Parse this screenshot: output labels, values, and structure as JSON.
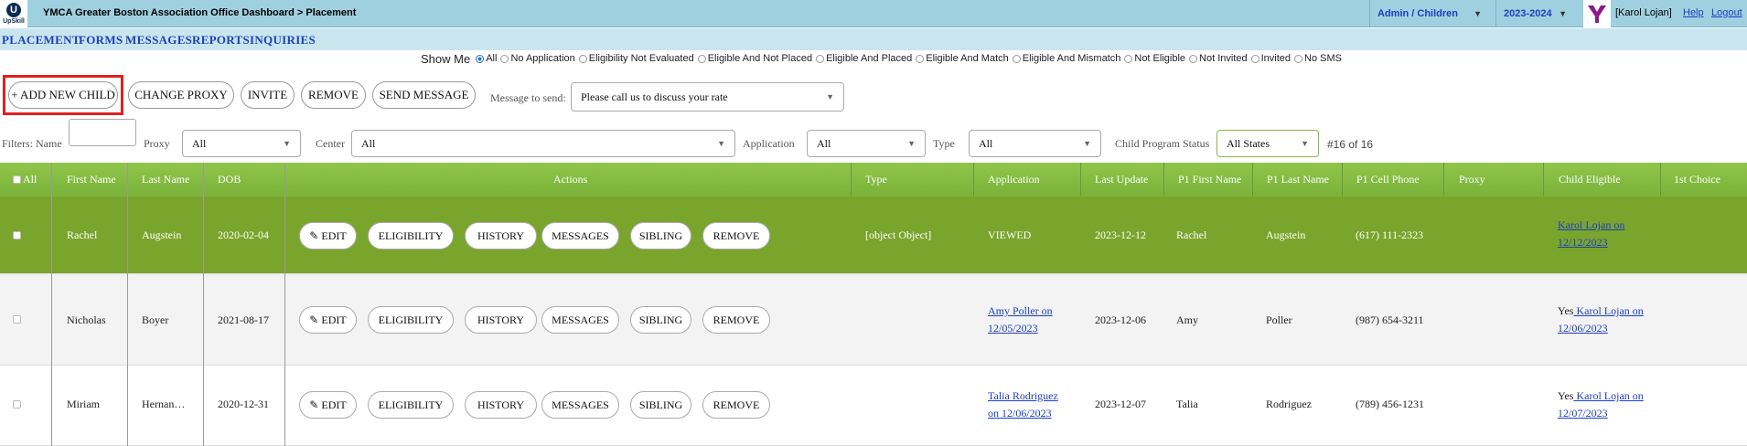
{
  "header": {
    "logo_text": "UpSkill",
    "title": "YMCA Greater Boston Association Office Dashboard > Placement",
    "role": "Admin / Children",
    "year": "2023-2024",
    "user": "[Karol Lojan]",
    "help": "Help",
    "logout": "Logout"
  },
  "nav": [
    "PLACEMENT",
    "FORMS",
    "MESSAGES",
    "REPORTS",
    "INQUIRIES"
  ],
  "show_me": {
    "label": "Show Me",
    "options": [
      "All",
      "No Application",
      "Eligibility Not Evaluated",
      "Eligible And Not Placed",
      "Eligible And Placed",
      "Eligible And Match",
      "Eligible And Mismatch",
      "Not Eligible",
      "Not Invited",
      "Invited",
      "No SMS"
    ],
    "selected": "All"
  },
  "actions": {
    "add_child": "+ ADD NEW CHILD",
    "change_proxy": "CHANGE PROXY",
    "invite": "INVITE",
    "remove": "REMOVE",
    "send_message": "SEND MESSAGE",
    "message_label": "Message to send:",
    "message_value": "Please call us to discuss your rate"
  },
  "filters": {
    "name_label": "Filters: Name",
    "proxy_label": "Proxy",
    "proxy_value": "All",
    "center_label": "Center",
    "center_value": "All",
    "application_label": "Application",
    "application_value": "All",
    "type_label": "Type",
    "type_value": "All",
    "status_label": "Child Program Status",
    "status_value": "All States",
    "count": "#16 of 16"
  },
  "table": {
    "all_label": "All",
    "headers": {
      "first": "First Name",
      "last": "Last Name",
      "dob": "DOB",
      "actions": "Actions",
      "type": "Type",
      "application": "Application",
      "last_update": "Last Update",
      "p1_first": "P1 First Name",
      "p1_last": "P1 Last Name",
      "p1_cell": "P1 Cell Phone",
      "proxy": "Proxy",
      "eligible": "Child Eligible",
      "choice": "1st Choice"
    },
    "row_buttons": {
      "edit": "EDIT",
      "eligibility": "ELIGIBILITY",
      "history": "HISTORY",
      "messages": "MESSAGES",
      "sibling": "SIBLING",
      "remove": "REMOVE"
    },
    "rows": [
      {
        "first": "Rachel",
        "last": "Augstein",
        "dob": "2020-02-04",
        "type": "[object Object]",
        "application_l1": "VIEWED",
        "application_l2": "",
        "last_update": "2023-12-12",
        "p1_first": "Rachel",
        "p1_last": "Augstein",
        "p1_cell": "(617) 111-2323",
        "proxy": "",
        "eligible_prefix": "",
        "eligible_l1": "Karol Lojan on",
        "eligible_l2": "12/12/2023"
      },
      {
        "first": "Nicholas",
        "last": "Boyer",
        "dob": "2021-08-17",
        "type": "",
        "application_l1": "Amy Poller on",
        "application_l2": "12/05/2023",
        "last_update": "2023-12-06",
        "p1_first": "Amy",
        "p1_last": "Poller",
        "p1_cell": "(987) 654-3211",
        "proxy": "",
        "eligible_prefix": "Yes",
        "eligible_l1": " Karol Lojan on",
        "eligible_l2": "12/06/2023"
      },
      {
        "first": "Miriam",
        "last": "Hernan…",
        "dob": "2020-12-31",
        "type": "",
        "application_l1": "Talia Rodriguez",
        "application_l2": "on 12/06/2023",
        "last_update": "2023-12-07",
        "p1_first": "Talia",
        "p1_last": "Rodriguez",
        "p1_cell": "(789) 456-1231",
        "proxy": "",
        "eligible_prefix": "Yes",
        "eligible_l1": " Karol Lojan on",
        "eligible_l2": "12/07/2023"
      }
    ]
  }
}
